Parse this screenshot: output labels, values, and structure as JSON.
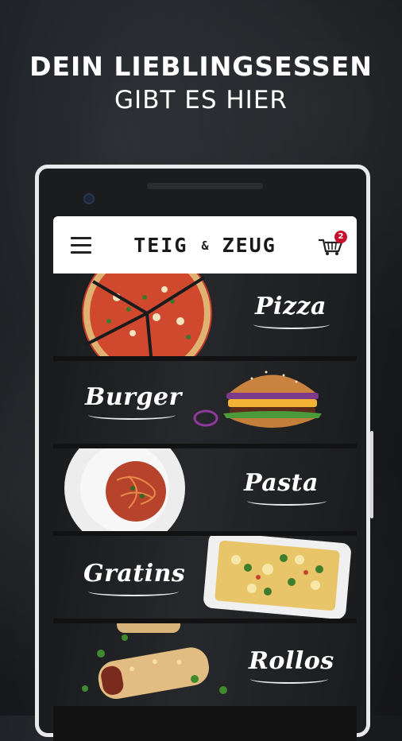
{
  "headline": {
    "line1": "DEIN LIEBLINGSESSEN",
    "line2": "GIBT ES HIER"
  },
  "app": {
    "brand_left": "TEIG",
    "brand_amp": "&",
    "brand_right": "ZEUG",
    "cart_count": "2"
  },
  "categories": [
    {
      "label": "Pizza"
    },
    {
      "label": "Burger"
    },
    {
      "label": "Pasta"
    },
    {
      "label": "Gratins"
    },
    {
      "label": "Rollos"
    }
  ],
  "colors": {
    "badge": "#c8102e",
    "frame": "#e9e9e9",
    "background": "#1a1c20"
  },
  "icons": [
    "menu-icon",
    "cart-icon"
  ]
}
